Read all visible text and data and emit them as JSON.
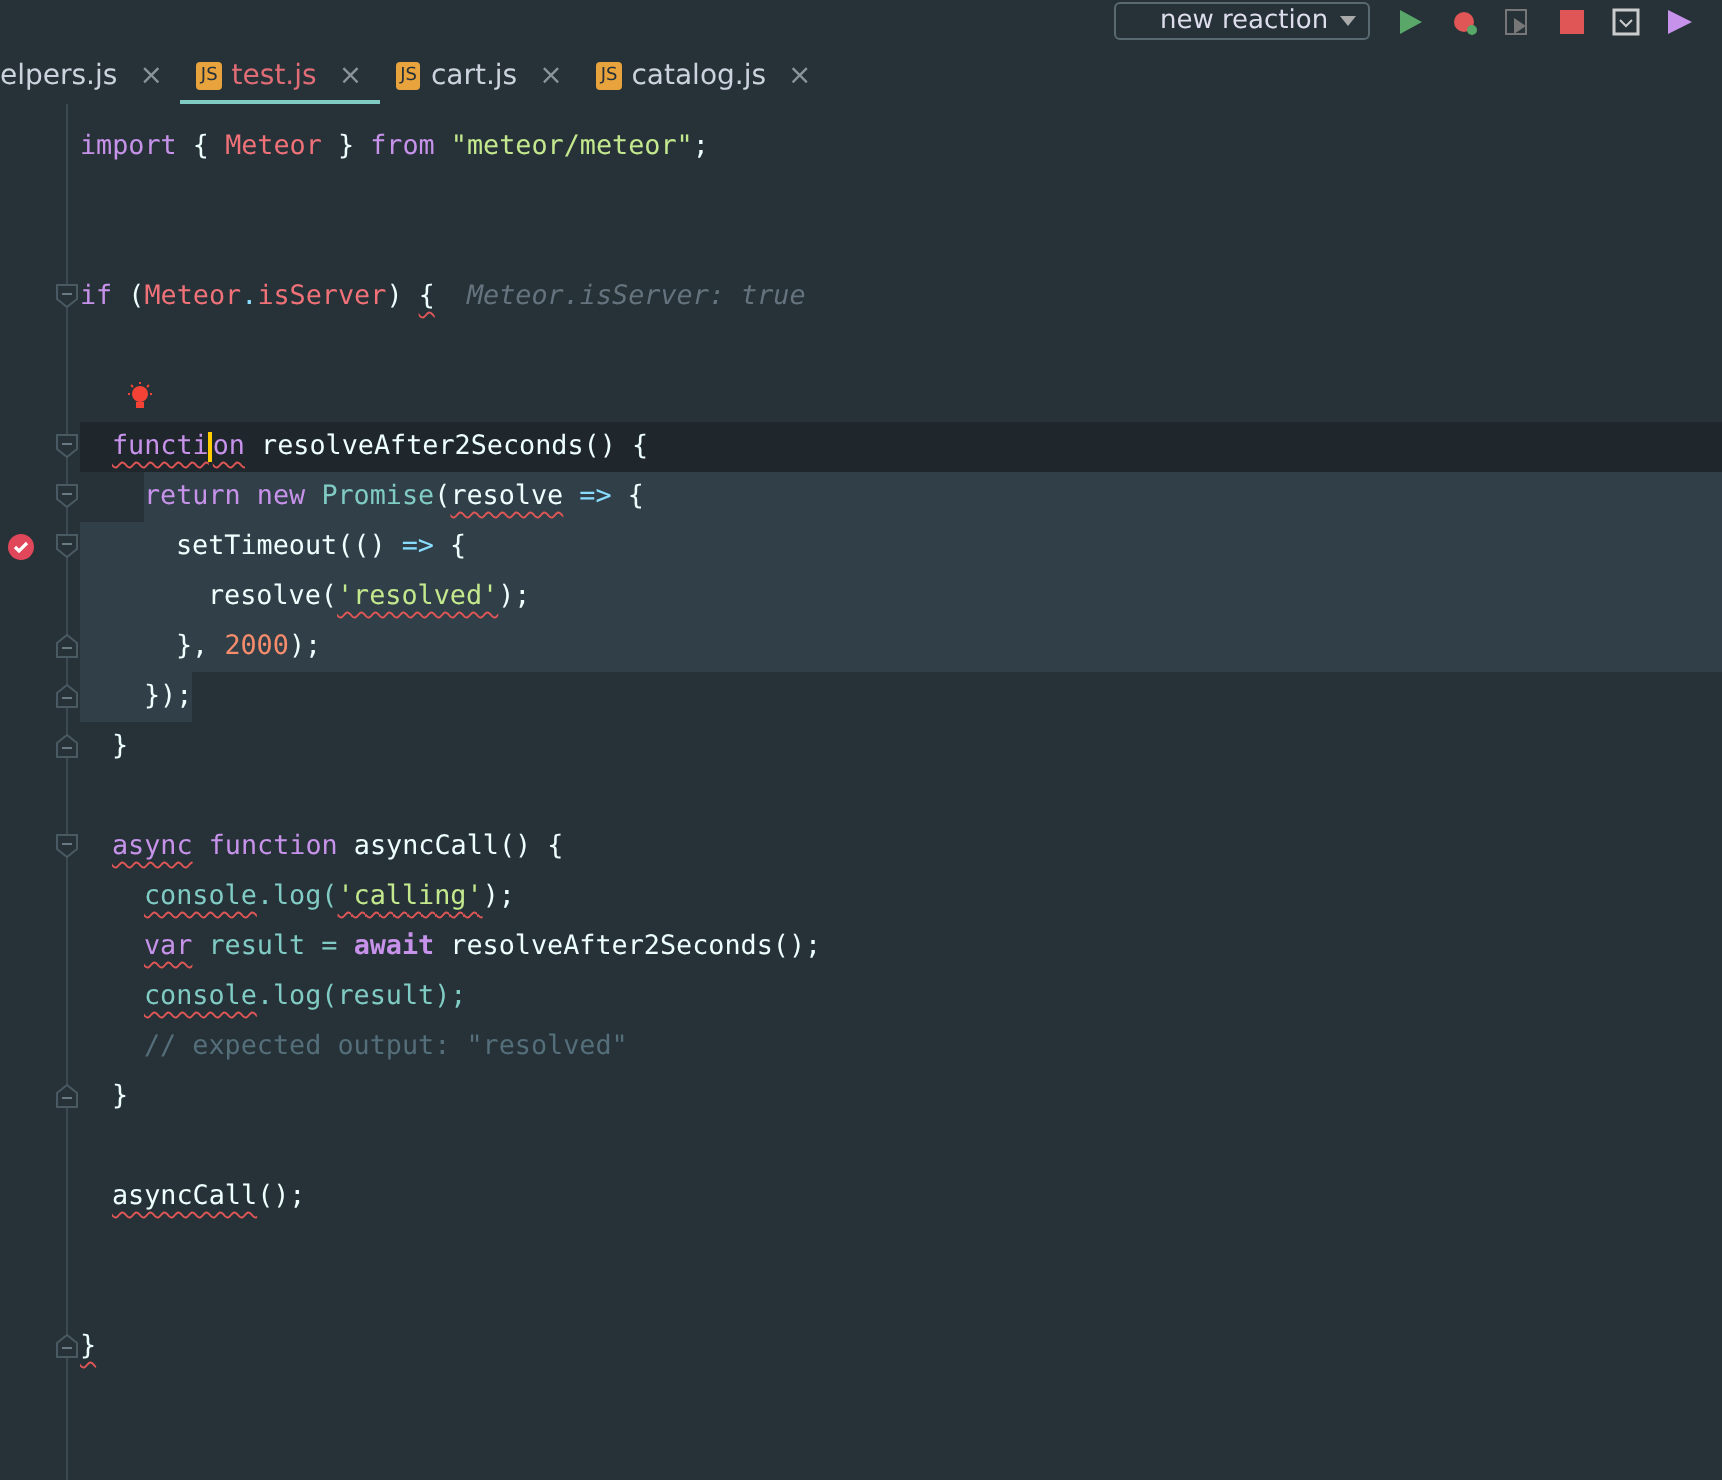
{
  "toolbar": {
    "run_config": "new reaction",
    "buttons": [
      {
        "kind": "run"
      },
      {
        "kind": "debug"
      },
      {
        "kind": "coverage"
      },
      {
        "kind": "stop"
      },
      {
        "kind": "save"
      },
      {
        "kind": "profile"
      }
    ]
  },
  "tabs": [
    {
      "label": "elpers.js",
      "selected": false,
      "close": "×"
    },
    {
      "label": "test.js",
      "selected": true,
      "icon_text": "JS",
      "close": "×"
    },
    {
      "label": "cart.js",
      "selected": false,
      "icon_text": "JS",
      "close": "×"
    },
    {
      "label": "catalog.js",
      "selected": false,
      "icon_text": "JS",
      "close": "×"
    }
  ],
  "lines": [
    {
      "kind": "code",
      "tokens": [
        {
          "t": "import",
          "kind": "kw"
        },
        {
          "t": " { ",
          "kind": "plain"
        },
        {
          "t": "Meteor",
          "kind": "var"
        },
        {
          "t": " } ",
          "kind": "plain"
        },
        {
          "t": "from",
          "kind": "kw"
        },
        {
          "t": " \"meteor/meteor\"",
          "kind": "str"
        },
        {
          "t": ";",
          "kind": "plain"
        }
      ]
    },
    {
      "kind": "blank"
    },
    {
      "kind": "blank"
    },
    {
      "kind": "code",
      "fold_start": true,
      "tokens": [
        {
          "t": "if",
          "kind": "kw"
        },
        {
          "t": " (",
          "kind": "plain"
        },
        {
          "t": "Meteor",
          "kind": "var"
        },
        {
          "t": ".",
          "kind": "punct"
        },
        {
          "t": "isServer",
          "kind": "var"
        },
        {
          "t": ") ",
          "kind": "plain"
        },
        {
          "t": "{",
          "kind": "plain",
          "squiggly": true
        },
        {
          "t": "  Meteor.isServer: true",
          "kind": "hint"
        }
      ],
      "children": [
        {
          "kind": "blank"
        },
        {
          "kind": "blank",
          "bulb": true
        },
        {
          "kind": "code",
          "fold_start": true,
          "current_line": true,
          "tokens": [
            {
              "t": "functi",
              "kind": "kw",
              "squiggly": true
            },
            {
              "t": "on",
              "kind": "kw",
              "squiggly": true,
              "caret": true
            },
            {
              "t": " resolveAfter2Seconds() {",
              "kind": "plain"
            }
          ],
          "children": [
            {
              "kind": "code",
              "fold_start": true,
              "selected": true,
              "tokens": [
                {
                  "t": "return new ",
                  "kind": "kw"
                },
                {
                  "t": "Promise",
                  "kind": "fn"
                },
                {
                  "t": "(",
                  "kind": "plain"
                },
                {
                  "t": "resolve",
                  "kind": "plain",
                  "squiggly": true
                },
                {
                  "t": " => ",
                  "kind": "punct"
                },
                {
                  "t": "{",
                  "kind": "plain"
                }
              ],
              "children": [
                {
                  "kind": "code",
                  "fold_start": true,
                  "breakpoint": true,
                  "selected": true,
                  "tokens": [
                    {
                      "t": "setTimeout(() ",
                      "kind": "plain"
                    },
                    {
                      "t": "=>",
                      "kind": "punct"
                    },
                    {
                      "t": " {",
                      "kind": "plain"
                    }
                  ],
                  "children": [
                    {
                      "kind": "code",
                      "selected": true,
                      "tokens": [
                        {
                          "t": "resolve(",
                          "kind": "plain"
                        },
                        {
                          "t": "'resolved'",
                          "kind": "str",
                          "squiggly": true
                        },
                        {
                          "t": ");",
                          "kind": "plain"
                        }
                      ]
                    }
                  ]
                },
                {
                  "kind": "code",
                  "fold_end": true,
                  "selected": true,
                  "tokens": [
                    {
                      "t": "}, ",
                      "kind": "plain"
                    },
                    {
                      "t": "2000",
                      "kind": "num"
                    },
                    {
                      "t": ");",
                      "kind": "plain"
                    }
                  ]
                }
              ]
            },
            {
              "kind": "code",
              "fold_end": true,
              "selected": true,
              "tokens": [
                {
                  "t": "});",
                  "kind": "plain"
                }
              ]
            }
          ]
        },
        {
          "kind": "code",
          "fold_end": true,
          "tokens": [
            {
              "t": "}",
              "kind": "plain"
            }
          ]
        },
        {
          "kind": "blank"
        },
        {
          "kind": "code",
          "fold_start": true,
          "tokens": [
            {
              "t": "async",
              "kind": "kw",
              "squiggly": true
            },
            {
              "t": " function",
              "kind": "kw"
            },
            {
              "t": " asyncCall() {",
              "kind": "plain"
            }
          ],
          "children": [
            {
              "kind": "code",
              "tokens": [
                {
                  "t": "console",
                  "kind": "fn",
                  "squiggly": true
                },
                {
                  "t": ".log(",
                  "kind": "fn"
                },
                {
                  "t": "'calling'",
                  "kind": "str",
                  "squiggly": true
                },
                {
                  "t": ");",
                  "kind": "plain"
                }
              ]
            },
            {
              "kind": "code",
              "tokens": [
                {
                  "t": "var",
                  "kind": "kw",
                  "squiggly": true
                },
                {
                  "t": " result = ",
                  "kind": "fn"
                },
                {
                  "t": "await",
                  "kind": "bold"
                },
                {
                  "t": " resolveAfter2Seconds();",
                  "kind": "plain"
                }
              ]
            },
            {
              "kind": "code",
              "tokens": [
                {
                  "t": "console",
                  "kind": "fn",
                  "squiggly": true
                },
                {
                  "t": ".log(result);",
                  "kind": "fn"
                }
              ]
            },
            {
              "kind": "code",
              "tokens": [
                {
                  "t": "// expected output: \"resolved\"",
                  "kind": "comment"
                }
              ]
            }
          ]
        },
        {
          "kind": "code",
          "fold_end": true,
          "tokens": [
            {
              "t": "}",
              "kind": "plain"
            }
          ]
        },
        {
          "kind": "blank"
        },
        {
          "kind": "code",
          "tokens": [
            {
              "t": "asyncCall",
              "kind": "plain",
              "squiggly": true
            },
            {
              "t": "();",
              "kind": "plain"
            }
          ]
        },
        {
          "kind": "blank"
        },
        {
          "kind": "blank"
        }
      ]
    },
    {
      "kind": "code",
      "fold_end": true,
      "tokens": [
        {
          "t": "}",
          "kind": "plain",
          "squiggly": true
        }
      ]
    }
  ]
}
